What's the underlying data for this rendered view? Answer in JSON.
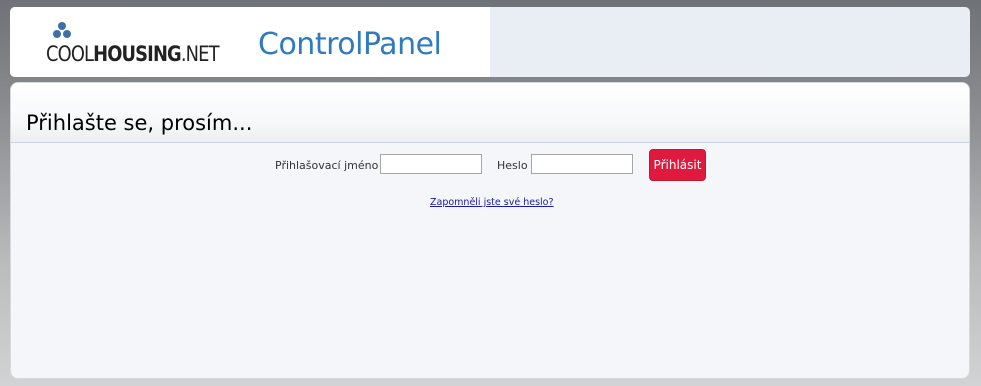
{
  "header": {
    "logo": {
      "part_cool": "COOL",
      "part_housing": "HOUSING",
      "part_net": ".NET"
    },
    "app_title": "ControlPanel"
  },
  "login": {
    "title": "Přihlašte se, prosím...",
    "username_label": "Přihlašovací jméno",
    "username_value": "",
    "password_label": "Heslo",
    "password_value": "",
    "submit_label": "Přihlásit",
    "forgot_link": "Zapomněli jste své heslo?"
  },
  "colors": {
    "brand_blue": "#2f7bbd",
    "button_red": "#e01a3f",
    "link_blue": "#1a1aa6"
  }
}
